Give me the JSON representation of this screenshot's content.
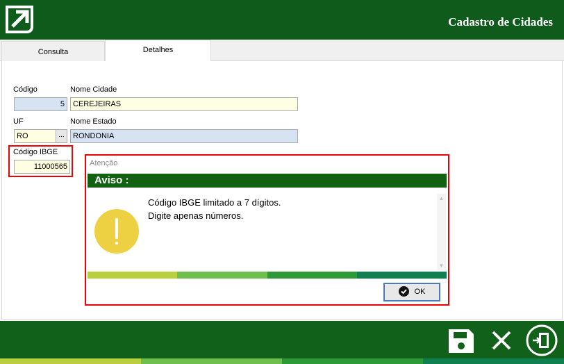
{
  "header": {
    "title": "Cadastro de Cidades",
    "logo": "arrow-logo-icon"
  },
  "tabs": [
    {
      "label": "Consulta"
    },
    {
      "label": "Detalhes"
    }
  ],
  "form": {
    "codigo_label": "Código",
    "codigo_value": "5",
    "nome_cidade_label": "Nome Cidade",
    "nome_cidade_value": "CEREJEIRAS",
    "uf_label": "UF",
    "uf_value": "RO",
    "uf_button": "...",
    "nome_estado_label": "Nome Estado",
    "nome_estado_value": "RONDONIA",
    "ibge_label": "Código IBGE",
    "ibge_value": "11000565"
  },
  "dialog": {
    "title": "Atenção",
    "heading": "Aviso :",
    "line1": "Código IBGE limitado a 7 dígitos.",
    "line2": "Digite apenas números.",
    "ok_label": "OK",
    "icon": "exclamation-icon"
  },
  "footer": {
    "icons": [
      "save-icon",
      "close-icon",
      "exit-icon"
    ]
  },
  "colors": {
    "brand_green": "#0e5b1c",
    "stripes": [
      "#b9cf3f",
      "#6fbf4e",
      "#2d9a37",
      "#108050"
    ],
    "highlight": "#e00000",
    "warning": "#eed043"
  }
}
